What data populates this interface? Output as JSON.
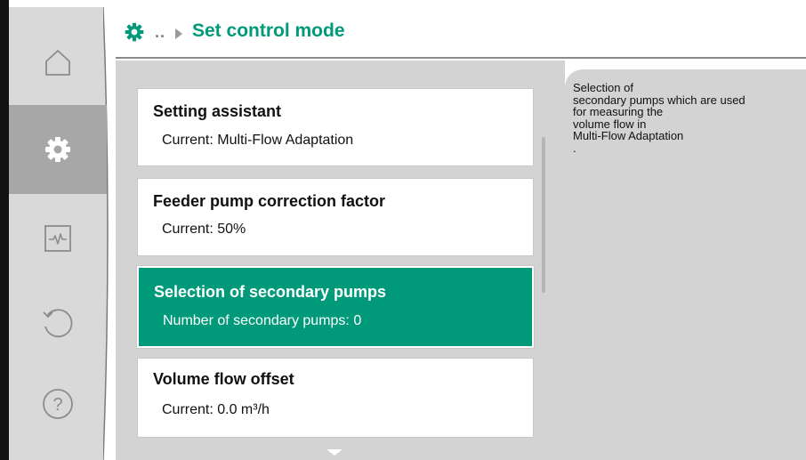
{
  "header": {
    "breadcrumb_dots": "..",
    "title": "Set control mode",
    "icon": "gear-icon"
  },
  "sidebar": {
    "items": [
      {
        "icon": "home-icon",
        "active": false
      },
      {
        "icon": "gear-icon",
        "active": true
      },
      {
        "icon": "diagnostics-icon",
        "active": false
      },
      {
        "icon": "back-icon",
        "active": false
      },
      {
        "icon": "help-icon",
        "active": false
      }
    ]
  },
  "list": {
    "items": [
      {
        "title": "Setting assistant",
        "subtitle": "Current: Multi-Flow Adaptation"
      },
      {
        "title": "Feeder pump correction factor",
        "subtitle": "Current: 50%"
      },
      {
        "title": "Selection of secondary pumps",
        "subtitle": "Number of secondary pumps: 0",
        "selected": true
      },
      {
        "title": "Volume flow offset",
        "subtitle": "Current: 0.0 m³/h"
      }
    ]
  },
  "help": {
    "lines": [
      "Selection of",
      "secondary pumps which are used",
      "for measuring the",
      "volume flow in",
      "Multi-Flow Adaptation",
      "."
    ]
  },
  "colors": {
    "accent": "#009a7a",
    "sidebar_bg": "#d9d9d9",
    "sidebar_active": "#a7a7a7",
    "panel_bg": "#d3d3d3"
  }
}
